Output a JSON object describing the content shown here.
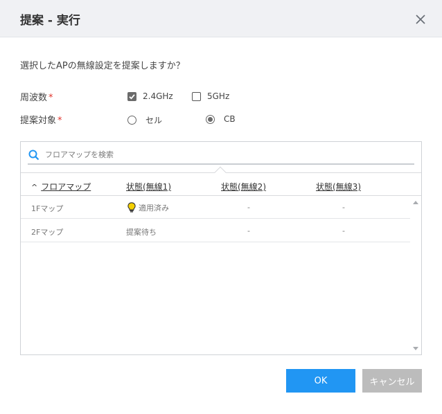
{
  "dialog": {
    "title": "提案 - 実行",
    "question": "選択したAPの無線設定を提案しますか？"
  },
  "frequency": {
    "label": "周波数",
    "required_mark": "*",
    "options": [
      {
        "label": "2.4GHz",
        "checked": true
      },
      {
        "label": "5GHz",
        "checked": false
      }
    ]
  },
  "target": {
    "label": "提案対象",
    "required_mark": "*",
    "options": [
      {
        "label": "セル",
        "selected": false
      },
      {
        "label": "CB",
        "selected": true
      }
    ]
  },
  "search": {
    "placeholder": "フロアマップを検索"
  },
  "table": {
    "sort_indicator": "^",
    "headers": [
      "フロアマップ",
      "状態(無線1)",
      "状態(無線2)",
      "状態(無線3)"
    ],
    "rows": [
      {
        "floor": "1Fマップ",
        "radio1": "適用済み",
        "radio2": "-",
        "radio3": "-",
        "radio1_icon": "lightbulb-icon"
      },
      {
        "floor": "2Fマップ",
        "radio1": "提案待ち",
        "radio2": "-",
        "radio3": "-"
      }
    ]
  },
  "buttons": {
    "ok": "OK",
    "cancel": "キャンセル"
  },
  "colors": {
    "primary": "#2196f3",
    "required": "#e0342c",
    "bulb": "#f5d000"
  }
}
